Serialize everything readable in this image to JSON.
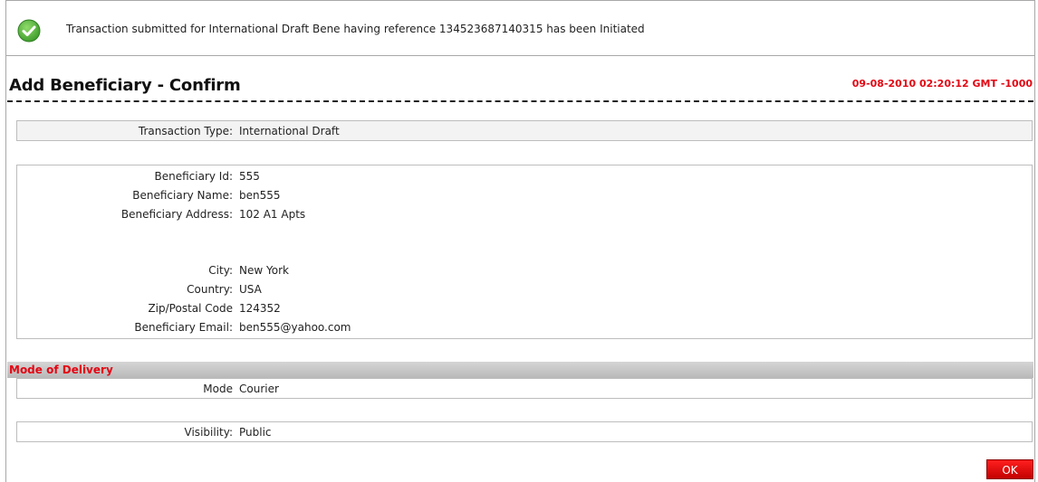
{
  "notification": {
    "icon": "check-circle-icon",
    "message": "Transaction submitted for International Draft Bene having reference 134523687140315 has been Initiated"
  },
  "page": {
    "title": "Add Beneficiary - Confirm",
    "timestamp": "09-08-2010 02:20:12 GMT -1000"
  },
  "transaction": {
    "type_label": "Transaction Type:",
    "type_value": "International Draft"
  },
  "beneficiary": {
    "id_label": "Beneficiary Id:",
    "id_value": "555",
    "name_label": "Beneficiary Name:",
    "name_value": "ben555",
    "address_label": "Beneficiary Address:",
    "address_value": "102 A1 Apts",
    "city_label": "City:",
    "city_value": "New York",
    "country_label": "Country:",
    "country_value": "USA",
    "zip_label": "Zip/Postal Code",
    "zip_value": "124352",
    "email_label": "Beneficiary Email:",
    "email_value": "ben555@yahoo.com"
  },
  "delivery": {
    "section_title": "Mode of Delivery",
    "mode_label": "Mode",
    "mode_value": "Courier"
  },
  "visibility": {
    "label": "Visibility:",
    "value": "Public"
  },
  "actions": {
    "ok_label": "OK"
  },
  "colors": {
    "accent_red": "#e30613",
    "success_green": "#4caf50"
  }
}
